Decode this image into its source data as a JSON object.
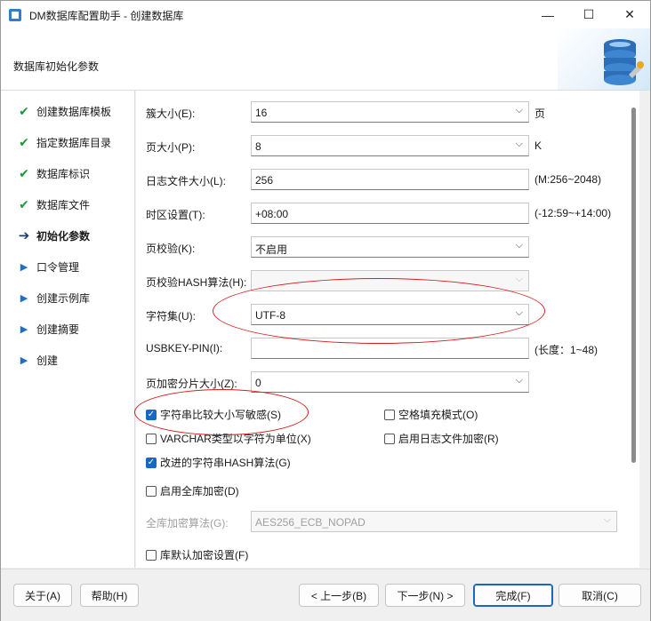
{
  "window": {
    "title": "DM数据库配置助手 - 创建数据库",
    "minimize": "—",
    "maximize": "☐",
    "close": "✕"
  },
  "header": {
    "title": "数据库初始化参数",
    "graphic_icon": "database-icon"
  },
  "nav": {
    "items": [
      {
        "label": "创建数据库模板",
        "status": "done",
        "icon": "check-icon"
      },
      {
        "label": "指定数据库目录",
        "status": "done",
        "icon": "check-icon"
      },
      {
        "label": "数据库标识",
        "status": "done",
        "icon": "check-icon"
      },
      {
        "label": "数据库文件",
        "status": "done",
        "icon": "check-icon"
      },
      {
        "label": "初始化参数",
        "status": "current",
        "icon": "arrow-right-bold-icon"
      },
      {
        "label": "口令管理",
        "status": "pending",
        "icon": "triangle-right-icon"
      },
      {
        "label": "创建示例库",
        "status": "pending",
        "icon": "triangle-right-icon"
      },
      {
        "label": "创建摘要",
        "status": "pending",
        "icon": "triangle-right-icon"
      },
      {
        "label": "创建",
        "status": "pending",
        "icon": "triangle-right-icon"
      }
    ]
  },
  "form": {
    "extent_size": {
      "label": "簇大小(E):",
      "value": "16",
      "suffix": "页"
    },
    "page_size": {
      "label": "页大小(P):",
      "value": "8",
      "suffix": "K"
    },
    "log_size": {
      "label": "日志文件大小(L):",
      "value": "256",
      "suffix": "(M:256~2048)"
    },
    "timezone": {
      "label": "时区设置(T):",
      "value": "+08:00",
      "suffix": "(-12:59~+14:00)"
    },
    "page_check": {
      "label": "页校验(K):",
      "value": "不启用"
    },
    "page_hash": {
      "label": "页校验HASH算法(H):",
      "value": ""
    },
    "charset": {
      "label": "字符集(U):",
      "value": "UTF-8"
    },
    "usbkey": {
      "label": "USBKEY-PIN(I):",
      "value": "",
      "suffix": "(长度：1~48)"
    },
    "page_enc_shard": {
      "label": "页加密分片大小(Z):",
      "value": "0"
    },
    "case_sensitive": {
      "label": "字符串比较大小写敏感(S)",
      "checked": true
    },
    "blank_pad": {
      "label": "空格填充模式(O)",
      "checked": false
    },
    "varchar_char": {
      "label": "VARCHAR类型以字符为单位(X)",
      "checked": false
    },
    "log_encrypt": {
      "label": "启用日志文件加密(R)",
      "checked": false
    },
    "improved_hash": {
      "label": "改进的字符串HASH算法(G)",
      "checked": true
    },
    "full_encrypt": {
      "label": "启用全库加密(D)",
      "checked": false
    },
    "encrypt_algo": {
      "label": "全库加密算法(G):",
      "value": "AES256_ECB_NOPAD"
    },
    "default_encrypt": {
      "label": "库默认加密设置(F)",
      "checked": false
    }
  },
  "footer": {
    "about": "关于(A)",
    "help": "帮助(H)",
    "back": "< 上一步(B)",
    "next": "下一步(N) >",
    "finish": "完成(F)",
    "cancel": "取消(C)"
  },
  "colors": {
    "accent": "#1767c4",
    "annotation": "#d62020",
    "check": "#1a9a3a"
  }
}
